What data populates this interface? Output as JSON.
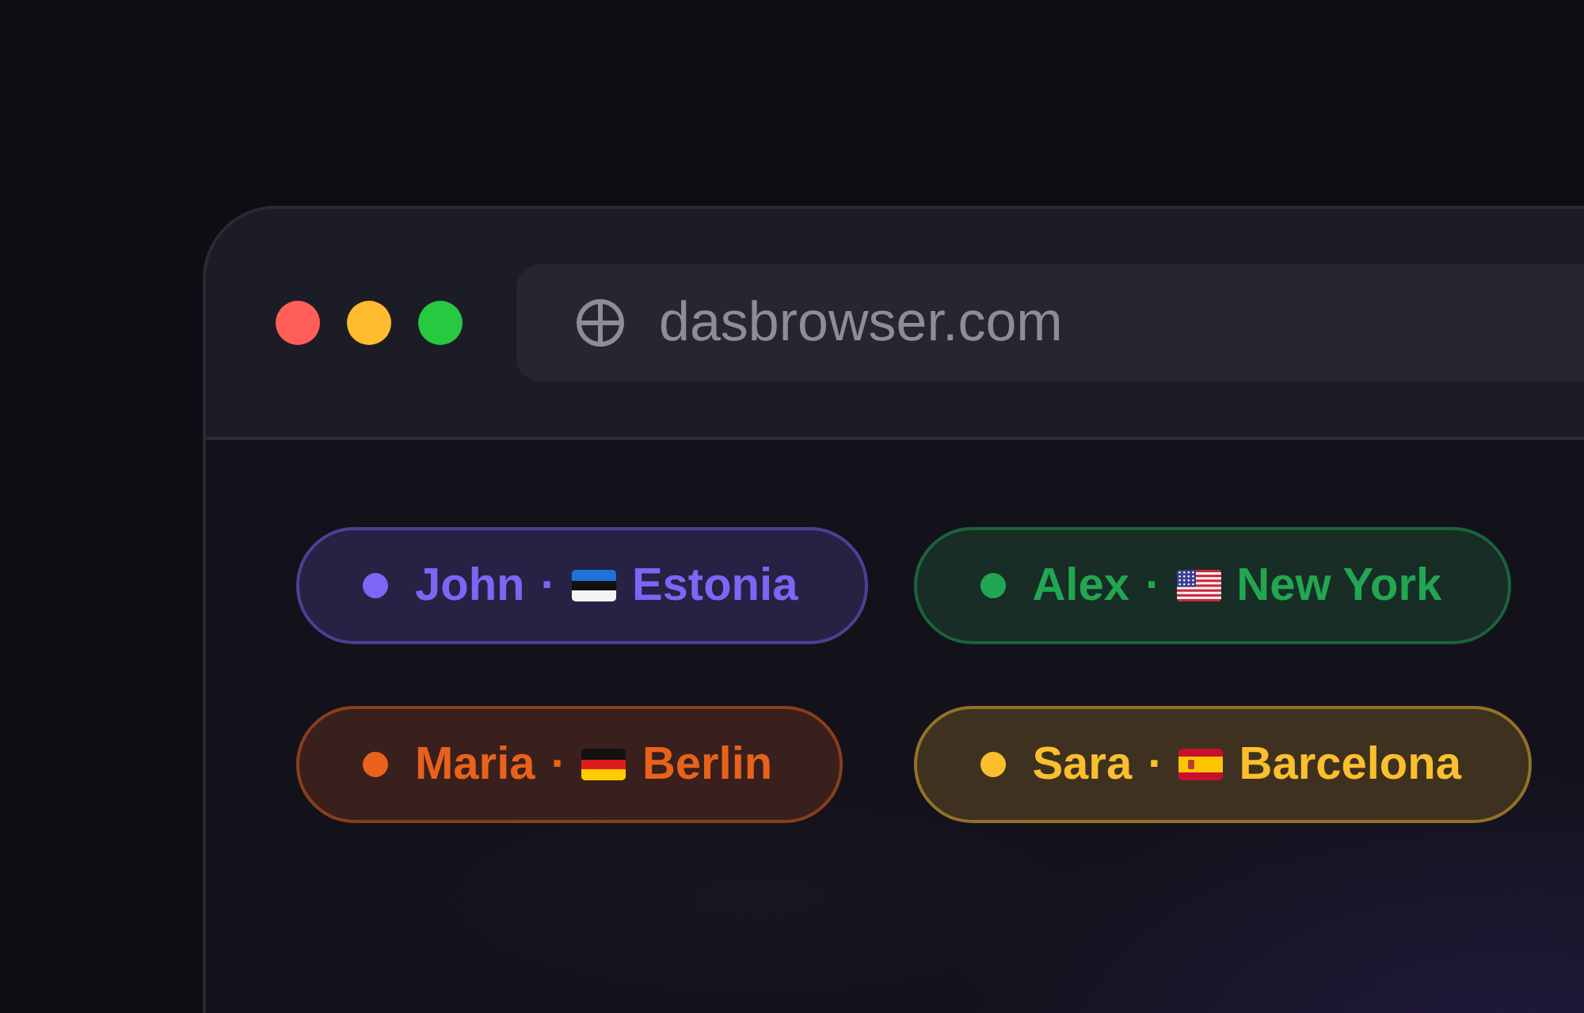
{
  "window": {
    "address_bar": {
      "url": "dasbrowser.com"
    }
  },
  "tags": [
    {
      "name": "John",
      "separator": "·",
      "flag": {
        "kind": "estonia"
      },
      "place": "Estonia",
      "color": "#7b66f5"
    },
    {
      "name": "Alex",
      "separator": "·",
      "flag": {
        "kind": "usa"
      },
      "place": "New York",
      "color": "#22a652"
    },
    {
      "name": "Maria",
      "separator": "·",
      "flag": {
        "kind": "germany"
      },
      "place": "Berlin",
      "color": "#e8621c"
    },
    {
      "name": "Sara",
      "separator": "·",
      "flag": {
        "kind": "spain"
      },
      "place": "Barcelona",
      "color": "#fbbf2e"
    }
  ]
}
